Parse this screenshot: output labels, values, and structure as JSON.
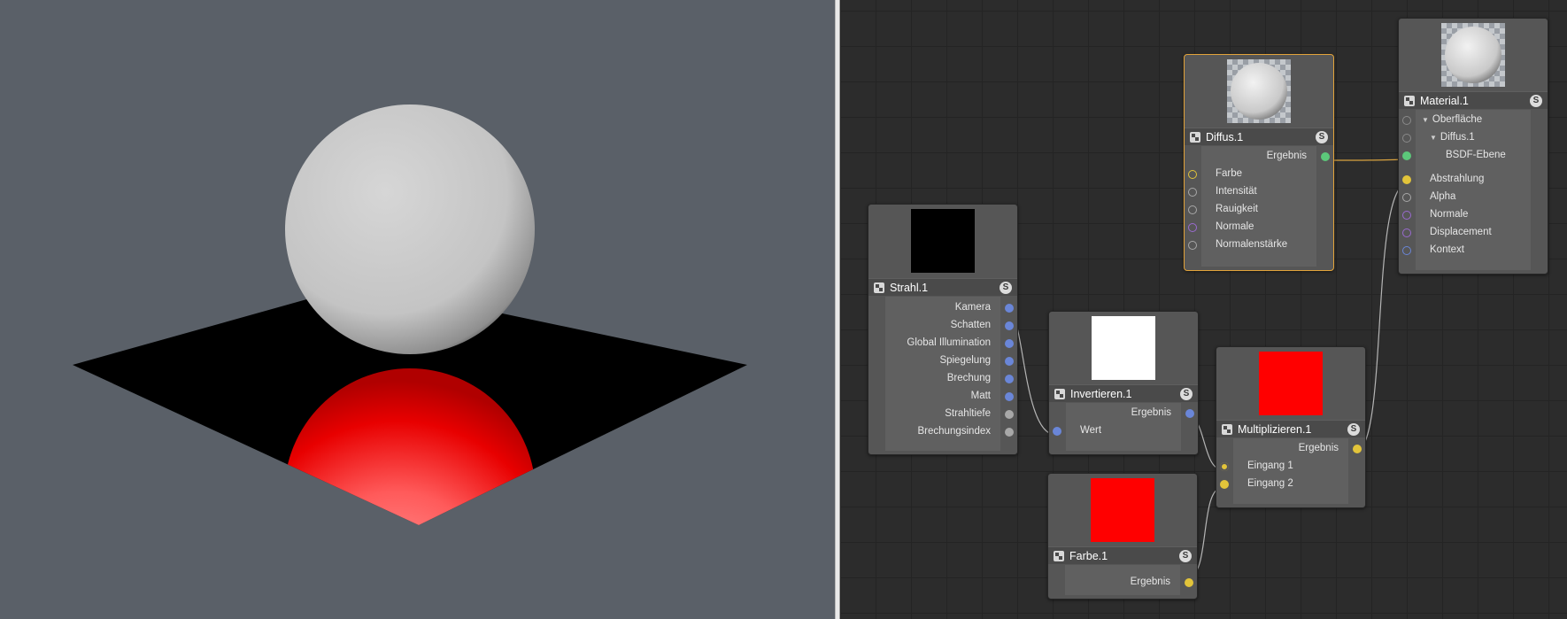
{
  "viewport": {
    "background": "#5a6068",
    "sphere_color": "#c9c9c9",
    "reflection_color": "#ff0000",
    "ground_color": "#000000"
  },
  "node_editor": {
    "background": "#2c2c2c",
    "wire_colors": {
      "selected": "#d9a340",
      "default": "#b5b5b5"
    },
    "solo_label": "S",
    "nodes": {
      "strahl": {
        "title": "Strahl.1",
        "preview_color": "#000000",
        "outputs": [
          {
            "label": "Kamera",
            "port_color": "#6a86d8"
          },
          {
            "label": "Schatten",
            "port_color": "#6a86d8"
          },
          {
            "label": "Global Illumination",
            "port_color": "#6a86d8"
          },
          {
            "label": "Spiegelung",
            "port_color": "#6a86d8"
          },
          {
            "label": "Brechung",
            "port_color": "#6a86d8"
          },
          {
            "label": "Matt",
            "port_color": "#6a86d8"
          },
          {
            "label": "Strahltiefe",
            "port_color": "#a8a8a8"
          },
          {
            "label": "Brechungsindex",
            "port_color": "#a8a8a8"
          }
        ]
      },
      "invertieren": {
        "title": "Invertieren.1",
        "preview_color": "#ffffff",
        "output": {
          "label": "Ergebnis",
          "port_color": "#6a86d8"
        },
        "inputs": [
          {
            "label": "Wert",
            "port_color": "#6a86d8"
          }
        ]
      },
      "farbe": {
        "title": "Farbe.1",
        "preview_color": "#ff0000",
        "output": {
          "label": "Ergebnis",
          "port_color": "#e2c43a"
        }
      },
      "multiplizieren": {
        "title": "Multiplizieren.1",
        "preview_color": "#ff0000",
        "output": {
          "label": "Ergebnis",
          "port_color": "#e2c43a"
        },
        "inputs": [
          {
            "label": "Eingang 1",
            "port_color": "#e2c43a"
          },
          {
            "label": "Eingang 2",
            "port_color": "#e2c43a"
          }
        ]
      },
      "diffus": {
        "title": "Diffus.1",
        "selected": true,
        "output": {
          "label": "Ergebnis",
          "port_color": "#5cc87a"
        },
        "inputs": [
          {
            "label": "Farbe",
            "port_color": "#e2c43a"
          },
          {
            "label": "Intensität",
            "port_color": "#a8a8a8"
          },
          {
            "label": "Rauigkeit",
            "port_color": "#a8a8a8"
          },
          {
            "label": "Normale",
            "port_color": "#9a6ad0"
          },
          {
            "label": "Normalenstärke",
            "port_color": "#a8a8a8"
          }
        ]
      },
      "material": {
        "title": "Material.1",
        "tree": [
          {
            "label": "Oberfläche",
            "port_color": "#8a8a8a",
            "expanded": true
          },
          {
            "label": "Diffus.1",
            "port_color": "#8a8a8a",
            "expanded": true
          },
          {
            "label": "BSDF-Ebene",
            "port_color": "#5cc87a"
          }
        ],
        "inputs": [
          {
            "label": "Abstrahlung",
            "port_color": "#e2c43a"
          },
          {
            "label": "Alpha",
            "port_color": "#a8a8a8"
          },
          {
            "label": "Normale",
            "port_color": "#9a6ad0"
          },
          {
            "label": "Displacement",
            "port_color": "#9a6ad0"
          },
          {
            "label": "Kontext",
            "port_color": "#6a86d8"
          }
        ]
      }
    }
  }
}
